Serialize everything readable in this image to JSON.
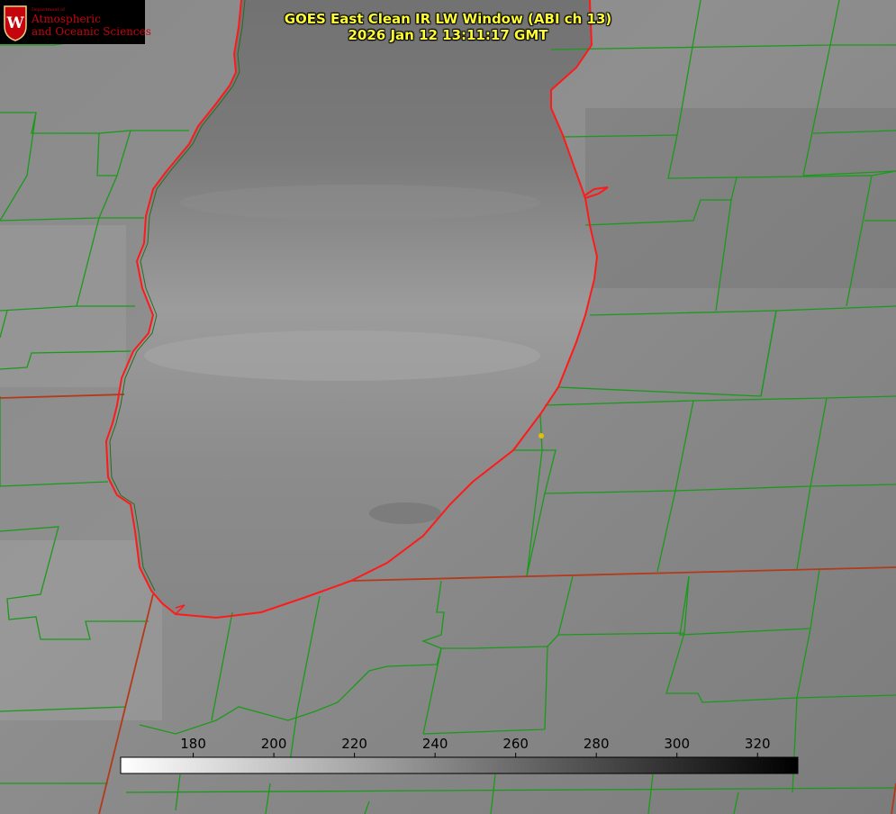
{
  "title": {
    "line1": "GOES East Clean IR LW Window (ABI ch 13)",
    "line2": "2026 Jan 12 13:11:17 GMT"
  },
  "logo": {
    "dept": "Department of",
    "line1": "Atmospheric",
    "line2": "and Oceanic Sciences",
    "seal_letter": "W"
  },
  "colorbar": {
    "min": 162,
    "max": 330,
    "ticks": [
      180,
      200,
      220,
      240,
      260,
      280,
      300,
      320
    ],
    "gradient_start": "#ffffff",
    "gradient_end": "#000000"
  },
  "colors": {
    "county_lines": "#1a9a1a",
    "state_lines": "#b33a1a",
    "lake_shoreline": "#ff1a1a",
    "title_text": "#ffff33",
    "logo_text": "#c5050c",
    "marker": "#e0c000"
  }
}
